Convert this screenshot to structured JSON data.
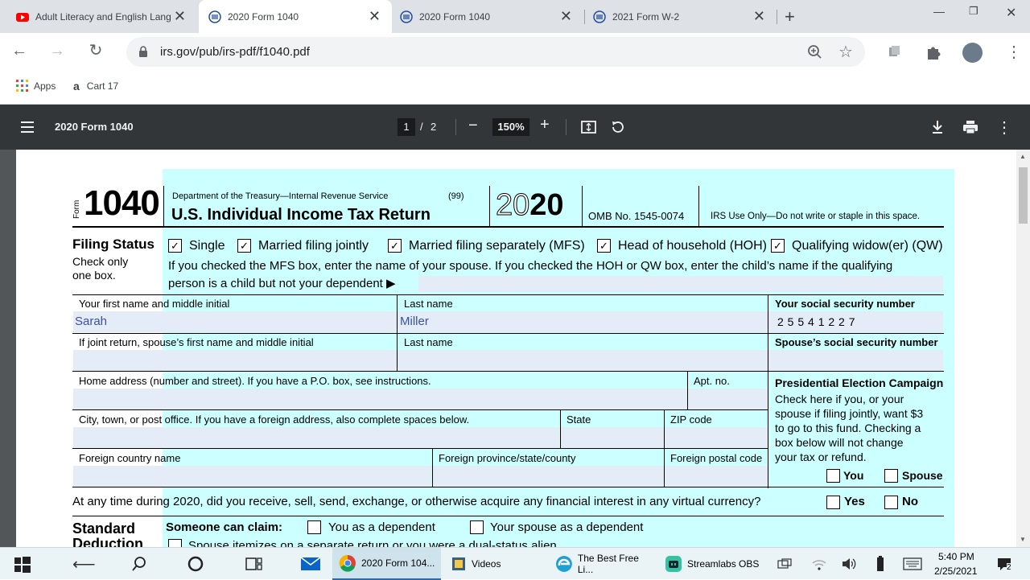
{
  "browser": {
    "tabs": [
      {
        "title": "Adult Literacy and English Lang",
        "icon": "youtube-icon"
      },
      {
        "title": "2020 Form 1040",
        "icon": "irs-icon",
        "active": true
      },
      {
        "title": "2020 Form 1040",
        "icon": "irs-icon"
      },
      {
        "title": "2021 Form W-2",
        "icon": "irs-icon"
      }
    ],
    "new_tab": "+",
    "url": "irs.gov/pub/irs-pdf/f1040.pdf",
    "bookmarks": [
      {
        "label": "Apps",
        "icon": "apps-grid-icon"
      },
      {
        "label": "Cart 17",
        "icon": "amazon-icon"
      }
    ]
  },
  "pdf": {
    "title": "2020 Form 1040",
    "page_current": "1",
    "page_sep": "/",
    "page_total": "2",
    "zoom": "150%",
    "zoom_out": "−",
    "zoom_in": "+"
  },
  "form": {
    "form_word": "Form",
    "form_number": "1040",
    "dept": "Department of the Treasury—Internal Revenue Service",
    "code": "(99)",
    "title": "U.S. Individual Income Tax Return",
    "year_light": "20",
    "year_bold": "20",
    "omb": "OMB No. 1545-0074",
    "irs_use": "IRS Use Only—Do not write or staple in this space.",
    "filing_status_heading": "Filing Status",
    "filing_status_sub1": "Check only",
    "filing_status_sub2": "one box.",
    "filing_options": [
      {
        "label": "Single",
        "mark": "✓"
      },
      {
        "label": "Married filing jointly",
        "mark": "✓"
      },
      {
        "label": "Married filing separately (MFS)",
        "mark": "✓"
      },
      {
        "label": "Head of household (HOH)",
        "mark": "✓"
      },
      {
        "label": "Qualifying widow(er) (QW)",
        "mark": "✓"
      }
    ],
    "mfs_note1": "If you checked the MFS box, enter the name of your spouse. If you checked the HOH or QW box, enter the child’s name if the qualifying",
    "mfs_note2": "person is a child but not your dependent ▶",
    "first_name_label": "Your first name and middle initial",
    "first_name_value": "Sarah",
    "last_name_label": "Last name",
    "last_name_value": "Miller",
    "ssn_label": "Your social security number",
    "ssn_value": "2 5 5 4 1 2 2 7",
    "spouse_first_label": "If joint return, spouse’s first name and middle initial",
    "spouse_last_label": "Last name",
    "spouse_ssn_label": "Spouse’s social security number",
    "home_address_label": "Home address (number and street). If you have a P.O. box, see instructions.",
    "apt_label": "Apt. no.",
    "pec_heading": "Presidential Election Campaign",
    "pec_text": [
      "Check here if you, or your",
      "spouse if filing jointly, want $3",
      "to go to this fund. Checking a",
      "box below will not change",
      "your tax or refund."
    ],
    "pec_you": "You",
    "pec_spouse": "Spouse",
    "city_label": "City, town, or post office. If you have a foreign address, also complete spaces below.",
    "state_label": "State",
    "zip_label": "ZIP code",
    "foreign_country_label": "Foreign country name",
    "foreign_province_label": "Foreign province/state/county",
    "foreign_postal_label": "Foreign postal code",
    "virtual_currency_q": "At any time during 2020, did you receive, sell, send, exchange, or otherwise acquire any financial interest in any virtual currency?",
    "yes": "Yes",
    "no": "No",
    "std_deduction_heading": "Standard",
    "std_deduction_heading2": "Deduction",
    "someone_can_claim": "Someone can claim:",
    "you_dependent": "You as a dependent",
    "spouse_dependent": "Your spouse as a dependent",
    "spouse_itemizes": "Spouse itemizes on a separate return or you were a dual-status alien"
  },
  "taskbar": {
    "apps": [
      {
        "label": "2020 Form 104...",
        "icon": "chrome-icon"
      },
      {
        "label": "Videos",
        "icon": "folder-icon"
      },
      {
        "label": "The Best Free Li...",
        "icon": "edge-icon"
      },
      {
        "label": "Streamlabs OBS",
        "icon": "streamlabs-icon"
      }
    ],
    "time": "5:40 PM",
    "date": "2/25/2021",
    "notifications": "2"
  }
}
